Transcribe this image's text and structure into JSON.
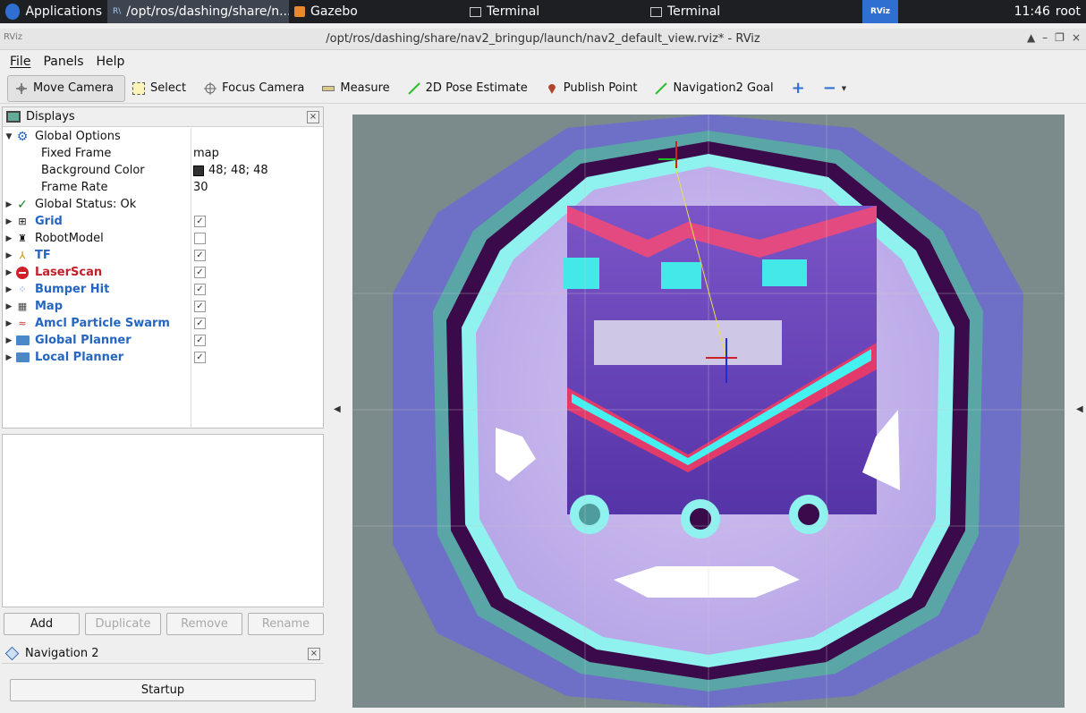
{
  "taskbar": {
    "applications": "Applications",
    "rviz_task": "/opt/ros/dashing/share/n...",
    "gazebo_task": "Gazebo",
    "terminal1": "Terminal",
    "terminal2": "Terminal",
    "active_badge": "RViz",
    "clock": "11:46",
    "user": "root"
  },
  "window": {
    "title": "/opt/ros/dashing/share/nav2_bringup/launch/nav2_default_view.rviz* - RViz",
    "logo": "RViz"
  },
  "menu": [
    "File",
    "Panels",
    "Help"
  ],
  "toolbar": {
    "move_camera": "Move Camera",
    "select": "Select",
    "focus_camera": "Focus Camera",
    "measure": "Measure",
    "pose_estimate": "2D Pose Estimate",
    "publish_point": "Publish Point",
    "nav_goal": "Navigation2 Goal",
    "plus": "+",
    "minus": "−"
  },
  "displays": {
    "title": "Displays",
    "global_options": "Global Options",
    "fixed_frame_label": "Fixed Frame",
    "fixed_frame_value": "map",
    "bg_color_label": "Background Color",
    "bg_color_value": "48; 48; 48",
    "bg_color_swatch": "#303030",
    "frame_rate_label": "Frame Rate",
    "frame_rate_value": "30",
    "global_status": "Global Status: Ok",
    "items": [
      {
        "label": "Grid",
        "checked": true,
        "style": "blue",
        "icon": "grid-icon"
      },
      {
        "label": "RobotModel",
        "checked": false,
        "style": "plain",
        "icon": "robot-icon"
      },
      {
        "label": "TF",
        "checked": true,
        "style": "blue",
        "icon": "tf-icon"
      },
      {
        "label": "LaserScan",
        "checked": true,
        "style": "red",
        "icon": "error-icon"
      },
      {
        "label": "Bumper Hit",
        "checked": true,
        "style": "blue",
        "icon": "points-icon"
      },
      {
        "label": "Map",
        "checked": true,
        "style": "blue",
        "icon": "map-icon"
      },
      {
        "label": "Amcl Particle Swarm",
        "checked": true,
        "style": "blue",
        "icon": "particle-icon"
      },
      {
        "label": "Global Planner",
        "checked": true,
        "style": "blue",
        "icon": "folder-icon"
      },
      {
        "label": "Local Planner",
        "checked": true,
        "style": "blue",
        "icon": "folder-icon"
      }
    ]
  },
  "buttons": {
    "add": "Add",
    "duplicate": "Duplicate",
    "remove": "Remove",
    "rename": "Rename"
  },
  "nav2": {
    "title": "Navigation 2",
    "startup": "Startup"
  },
  "close_glyph": "×",
  "check_glyph": "✓"
}
